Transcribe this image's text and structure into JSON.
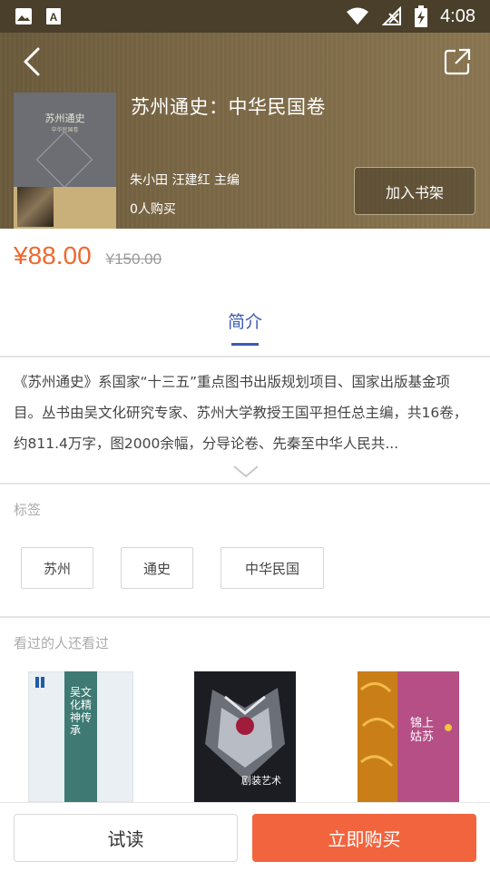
{
  "status_bar": {
    "time": "4:08",
    "icons": [
      "image-icon",
      "a-icon",
      "wifi-icon",
      "no-signal-icon",
      "battery-charging-icon"
    ]
  },
  "header": {
    "back_icon": "chevron-left-icon",
    "share_icon": "share-icon"
  },
  "book": {
    "title": "苏州通史：中华民国卷",
    "authors": "朱小田  汪建红  主编",
    "buyers": "0人购买",
    "add_to_shelf": "加入书架",
    "cover_title": "苏州通史",
    "cover_subtitle": "中华民国卷"
  },
  "price": {
    "current": "¥88.00",
    "original": "¥150.00",
    "current_color": "#f0672f"
  },
  "tabs": {
    "intro": "简介",
    "active_color": "#3c5bb3"
  },
  "intro": {
    "text": "《苏州通史》系国家“十三五”重点图书出版规划项目、国家出版基金项目。丛书由吴文化研究专家、苏州大学教授王国平担任总主编，共16卷，约811.4万字，图2000余幅，分导论卷、先秦至中华人民共..."
  },
  "tags_section": {
    "label": "标签",
    "tags": [
      "苏州",
      "通史",
      "中华民国"
    ]
  },
  "recommend": {
    "label": "看过的人还看过",
    "books": [
      {
        "cover_text": "吴文化精神传承"
      },
      {
        "cover_text": "剧装艺术"
      },
      {
        "cover_text": "锦上姑苏"
      }
    ]
  },
  "bottom_bar": {
    "trial": "试读",
    "buy_now": "立即购买",
    "buy_color": "#f2643e"
  }
}
